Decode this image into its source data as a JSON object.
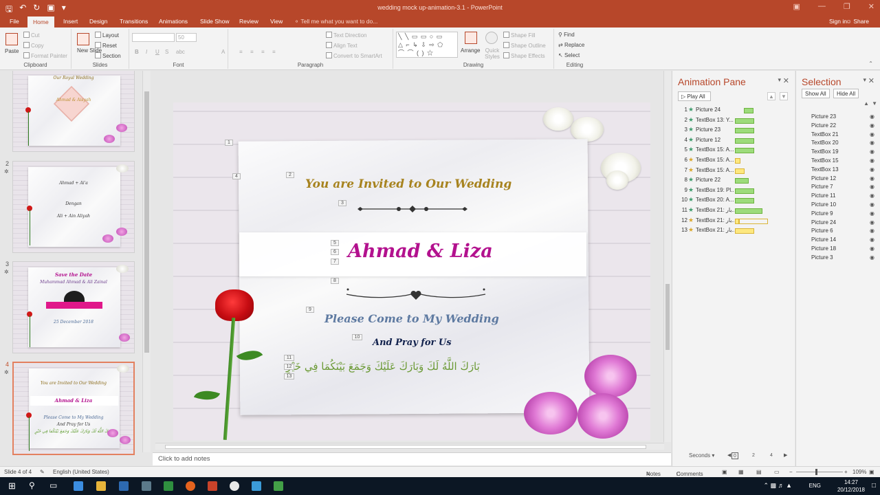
{
  "titlebar": {
    "doc_title": "wedding mock up-animation-3.1 - PowerPoint",
    "qat_icons": [
      "save-icon",
      "undo-icon",
      "redo-icon",
      "present-icon",
      "customize-icon"
    ]
  },
  "tabs": [
    "File",
    "Home",
    "Insert",
    "Design",
    "Transitions",
    "Animations",
    "Slide Show",
    "Review",
    "View"
  ],
  "tellme": "Tell me what you want to do...",
  "signin": "Sign in",
  "share": "Share",
  "ribbon": {
    "clipboard": {
      "label": "Clipboard",
      "paste": "Paste",
      "cut": "Cut",
      "copy": "Copy",
      "format_painter": "Format Painter"
    },
    "slides": {
      "label": "Slides",
      "new_slide": "New Slide",
      "layout": "Layout",
      "reset": "Reset",
      "section": "Section"
    },
    "font": {
      "label": "Font",
      "size": "50"
    },
    "paragraph": {
      "label": "Paragraph",
      "text_direction": "Text Direction",
      "align_text": "Align Text",
      "convert": "Convert to SmartArt"
    },
    "drawing": {
      "label": "Drawing",
      "arrange": "Arrange",
      "quick_styles": "Quick Styles",
      "shape_fill": "Shape Fill",
      "shape_outline": "Shape Outline",
      "shape_effects": "Shape Effects"
    },
    "editing": {
      "label": "Editing",
      "find": "Find",
      "replace": "Replace",
      "select": "Select"
    }
  },
  "thumbnails": [
    {
      "number": "",
      "title": "Our Royal Wedding",
      "names": "Ahmad & Aisyah"
    },
    {
      "number": "2",
      "lines": [
        "Ahmad + Ai'a",
        "Dengan",
        "Ali + Ain Aliyah"
      ]
    },
    {
      "number": "3",
      "lines": [
        "Save the Date",
        "Muhammad Ahmad & Ali Zainal",
        "25 December 2018"
      ]
    },
    {
      "number": "4",
      "lines": [
        "You are Invited to Our Wedding",
        "Ahmad & Liza",
        "Please Come to My Wedding",
        "And Pray for Us"
      ]
    }
  ],
  "slide": {
    "invite": "You are Invited to Our Wedding",
    "names": "Ahmad & Liza",
    "please": "Please Come to My Wedding",
    "pray": "And Pray for Us",
    "arabic": "بَارَكَ اللَّهُ لَكَ وَبَارَكَ عَلَيْكَ وَجَمَعَ بَيْنَكُمَا فِي خَيْرٍ",
    "tags": [
      "1",
      "2",
      "3",
      "4",
      "5",
      "6",
      "7",
      "8",
      "9",
      "10",
      "11",
      "12",
      "13"
    ]
  },
  "notes_placeholder": "Click to add notes",
  "animation_pane": {
    "title": "Animation Pane",
    "play_all": "Play All",
    "items": [
      {
        "num": "1",
        "name": "Picture 24",
        "color": "green"
      },
      {
        "num": "2",
        "name": "TextBox 13: Y...",
        "color": "green"
      },
      {
        "num": "3",
        "name": "Picture 23",
        "color": "green"
      },
      {
        "num": "4",
        "name": "Picture 12",
        "color": "green"
      },
      {
        "num": "5",
        "name": "TextBox 15: A...",
        "color": "green"
      },
      {
        "num": "6",
        "name": "TextBox 15: A...",
        "color": "yellow"
      },
      {
        "num": "7",
        "name": "TextBox 15: A...",
        "color": "yellow"
      },
      {
        "num": "8",
        "name": "Picture 22",
        "color": "green"
      },
      {
        "num": "9",
        "name": "TextBox 19: Pl...",
        "color": "green"
      },
      {
        "num": "10",
        "name": "TextBox 20: A...",
        "color": "green"
      },
      {
        "num": "11",
        "name": "TextBox 21: ﺑﺎر...",
        "color": "green"
      },
      {
        "num": "12",
        "name": "TextBox 21: ﺑﺎر...",
        "color": "yellow"
      },
      {
        "num": "13",
        "name": "TextBox 21: ﺑﺎر...",
        "color": "yellow"
      }
    ],
    "seconds": "Seconds",
    "ticks": [
      "0",
      "2",
      "4"
    ]
  },
  "selection_pane": {
    "title": "Selection",
    "show_all": "Show All",
    "hide_all": "Hide All",
    "items": [
      "Picture 23",
      "Picture 22",
      "TextBox 21",
      "TextBox 20",
      "TextBox 19",
      "TextBox 15",
      "TextBox 13",
      "Picture 12",
      "Picture 7",
      "Picture 11",
      "Picture 10",
      "Picture 9",
      "Picture 24",
      "Picture 6",
      "Picture 14",
      "Picture 18",
      "Picture 3"
    ]
  },
  "status": {
    "slide": "Slide 4 of 4",
    "language": "English (United States)",
    "notes": "Notes",
    "comments": "Comments",
    "zoom": "109%"
  },
  "taskbar": {
    "lang": "ENG",
    "time": "14:27",
    "date": "20/12/2018"
  },
  "colors": {
    "accent": "#b7472a",
    "names": "#b3118e",
    "invite": "#a7831f",
    "please": "#5e7aa1",
    "arabic": "#6b9a35"
  }
}
